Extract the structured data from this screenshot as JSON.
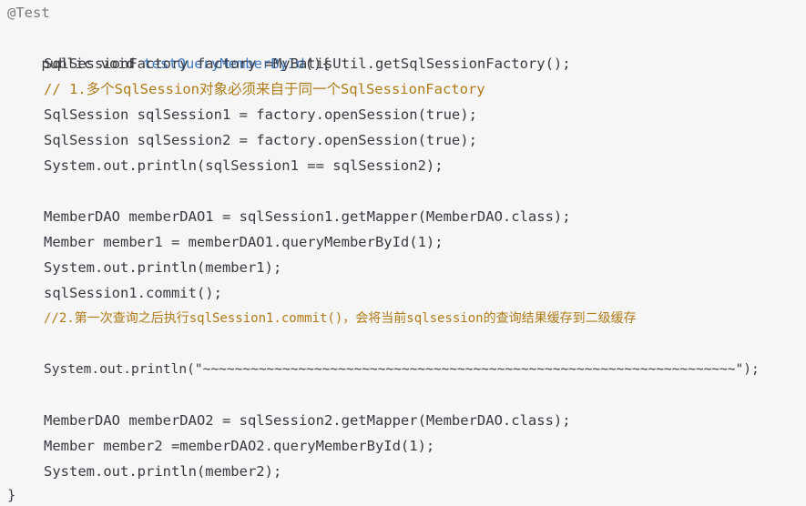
{
  "code_lines": [
    {
      "text": "@Test",
      "kind": "annotation"
    },
    {
      "text": "public void testQueryMemberById(){",
      "kind": "signature"
    },
    {
      "text": "SqlSessionFactory factory =MyBatisUtil.getSqlSessionFactory();",
      "kind": "code"
    },
    {
      "text": "// 1.多个SqlSession对象必须来自于同一个SqlSessionFactory",
      "kind": "comment"
    },
    {
      "text": "SqlSession sqlSession1 = factory.openSession(true);",
      "kind": "code"
    },
    {
      "text": "SqlSession sqlSession2 = factory.openSession(true);",
      "kind": "code"
    },
    {
      "text": "System.out.println(sqlSession1 == sqlSession2);",
      "kind": "code"
    },
    {
      "text": "",
      "kind": "blank"
    },
    {
      "text": "MemberDAO memberDAO1 = sqlSession1.getMapper(MemberDAO.class);",
      "kind": "code"
    },
    {
      "text": "Member member1 = memberDAO1.queryMemberById(1);",
      "kind": "code"
    },
    {
      "text": "System.out.println(member1);",
      "kind": "code"
    },
    {
      "text": "sqlSession1.commit();",
      "kind": "code"
    },
    {
      "text": "//2.第一次查询之后执行sqlSession1.commit()，会将当前sqlsession的查询结果缓存到二级缓存",
      "kind": "comment"
    },
    {
      "text": "",
      "kind": "blank"
    },
    {
      "text": "System.out.println(\"~~~~~~~~~~~~~~~~~~~~~~~~~~~~~~~~~~~~~~~~~~~~~~~~~~~~~~~~~~~~~~~~~~~\");",
      "kind": "code"
    },
    {
      "text": "",
      "kind": "blank"
    },
    {
      "text": "MemberDAO memberDAO2 = sqlSession2.getMapper(MemberDAO.class);",
      "kind": "code"
    },
    {
      "text": "Member member2 =memberDAO2.queryMemberById(1);",
      "kind": "code"
    },
    {
      "text": "System.out.println(member2);",
      "kind": "code"
    },
    {
      "text": "}",
      "kind": "closing"
    }
  ]
}
